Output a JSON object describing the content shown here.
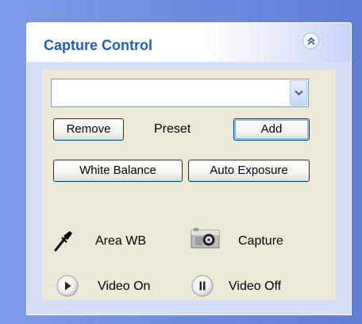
{
  "panel": {
    "title": "Capture Control",
    "collapse_icon": "double-chevron-up-icon"
  },
  "controls": {
    "preset_combo_value": "",
    "preset_combo_icon": "chevron-down-icon",
    "remove_label": "Remove",
    "preset_label": "Preset",
    "add_label": "Add",
    "white_balance_label": "White Balance",
    "auto_exposure_label": "Auto Exposure",
    "area_wb_label": "Area WB",
    "area_wb_icon": "eyedropper-icon",
    "capture_label": "Capture",
    "capture_icon": "camera-icon",
    "video_on_label": "Video On",
    "video_on_icon": "play-icon",
    "video_off_label": "Video Off",
    "video_off_icon": "pause-icon"
  },
  "colors": {
    "title_blue": "#215dc6",
    "panel_blue": "#d6dff7",
    "body_beige": "#ece9d8",
    "button_border": "#003c74"
  }
}
